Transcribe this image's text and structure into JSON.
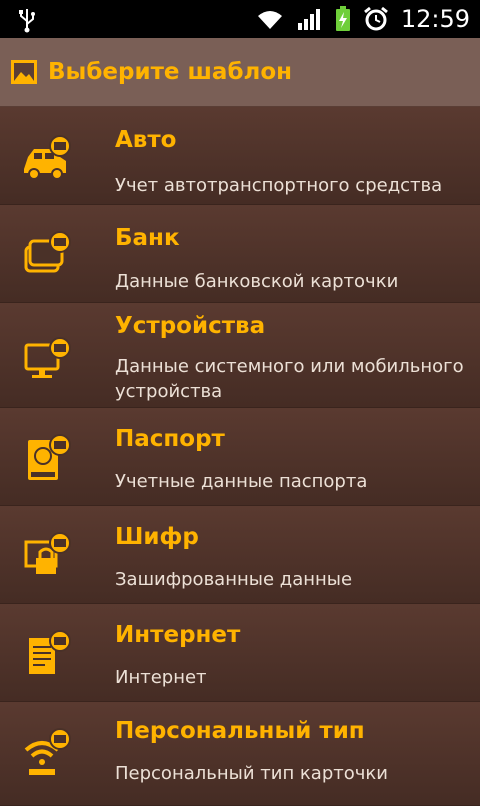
{
  "status_bar": {
    "time": "12:59",
    "icons": [
      "usb-icon",
      "wifi-icon",
      "signal-icon",
      "battery-icon",
      "alarm-icon"
    ]
  },
  "header": {
    "title": "Выберите шаблон",
    "icon": "image-icon"
  },
  "colors": {
    "accent": "#ffb300",
    "header_bg": "#7a5f56",
    "row_bg": "#4a3128",
    "subtitle": "#ece0d6"
  },
  "templates": [
    {
      "title": "Авто",
      "subtitle": "Учет автотранспортного средства",
      "icon": "car-icon"
    },
    {
      "title": "Банк",
      "subtitle": "Данные банковской карточки",
      "icon": "bank-card-icon"
    },
    {
      "title": "Устройства",
      "subtitle": "Данные системного или мобильного устройства",
      "icon": "monitor-icon"
    },
    {
      "title": "Паспорт",
      "subtitle": "Учетные данные паспорта",
      "icon": "passport-icon"
    },
    {
      "title": "Шифр",
      "subtitle": "Зашифрованные данные",
      "icon": "cipher-icon"
    },
    {
      "title": "Интернет",
      "subtitle": "Интернет",
      "icon": "internet-document-icon"
    },
    {
      "title": "Персональный тип",
      "subtitle": "Персональный тип карточки",
      "icon": "wifi-card-icon"
    }
  ]
}
